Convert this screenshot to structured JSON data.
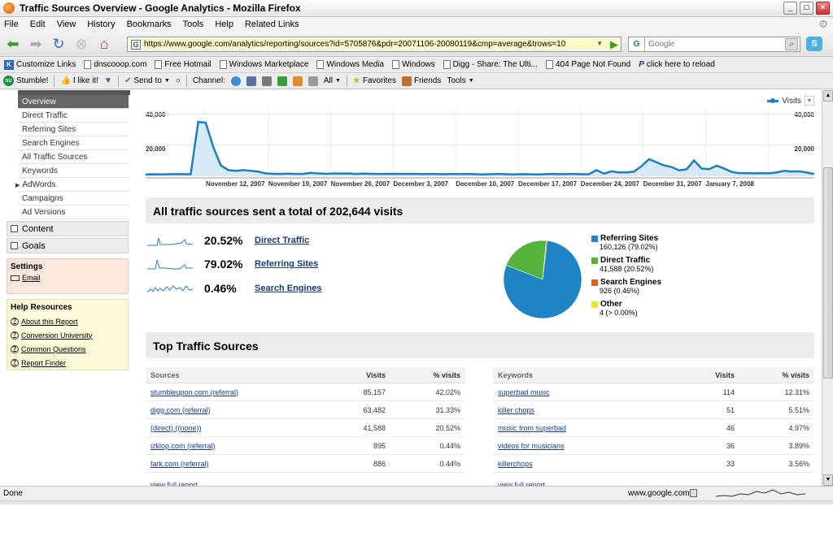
{
  "window": {
    "title": "Traffic Sources Overview - Google Analytics - Mozilla Firefox",
    "min_label": "_",
    "max_label": "□",
    "close_label": "×"
  },
  "menu": [
    "File",
    "Edit",
    "View",
    "History",
    "Bookmarks",
    "Tools",
    "Help",
    "Related Links"
  ],
  "nav": {
    "url": "https://www.google.com/analytics/reporting/sources?id=5705876&pdr=20071106-20080119&cmp=average&trows=10",
    "search_placeholder": "Google",
    "search_engine": "G",
    "skype": "S"
  },
  "bookmarks": [
    "Customize Links",
    "dnscooop.com",
    "Free Hotmail",
    "Windows Marketplace",
    "Windows Media",
    "Windows",
    "Digg - Share: The Ulti...",
    "404 Page Not Found",
    "click here to reload"
  ],
  "stumble": {
    "stumble": "Stumble!",
    "ilike": "I like it!",
    "sendto": "Send to",
    "channel": "Channel:",
    "all": "All",
    "favorites": "Favorites",
    "friends": "Friends",
    "tools": "Tools"
  },
  "sidebar": {
    "items": [
      "Overview",
      "Direct Traffic",
      "Referring Sites",
      "Search Engines",
      "All Traffic Sources",
      "Keywords",
      "AdWords",
      "Campaigns",
      "Ad Versions"
    ],
    "content_label": "Content",
    "goals_label": "Goals",
    "settings_title": "Settings",
    "email_label": "Email",
    "help_title": "Help Resources",
    "help_links": [
      "About this Report",
      "Conversion University",
      "Common Questions",
      "Report Finder"
    ]
  },
  "chart_data": {
    "type": "line",
    "legend": "Visits",
    "yticks": [
      "40,000",
      "20,000"
    ],
    "ylim": [
      0,
      45000
    ],
    "x_labels": [
      "November 12, 2007",
      "November 19, 2007",
      "November 26, 2007",
      "December 3, 2007",
      "December 10, 2007",
      "December 17, 2007",
      "December 24, 2007",
      "December 31, 2007",
      "January 7, 2008"
    ],
    "values": [
      1200,
      1300,
      1250,
      1300,
      1350,
      1400,
      1300,
      35000,
      34500,
      19000,
      7000,
      4000,
      3500,
      4000,
      3500,
      3000,
      1800,
      1600,
      1500,
      1700,
      1500,
      1600,
      2200,
      1800,
      1600,
      1800,
      1700,
      1800,
      1500,
      1700,
      1600,
      1500,
      1500,
      1600,
      1500,
      1600,
      1500,
      1400,
      1500,
      1400,
      1400,
      1500,
      1400,
      1500,
      1300,
      1200,
      1400,
      1500,
      1300,
      1200,
      1400,
      1300,
      1200,
      1300,
      1500,
      1400,
      1400,
      1500,
      1300,
      1300,
      4000,
      1700,
      3200,
      2500,
      2500,
      3000,
      6500,
      11000,
      9000,
      7000,
      6000,
      3800,
      4500,
      10200,
      5000,
      4600,
      6800,
      5000,
      2800,
      2000,
      2000,
      1900,
      2000,
      1900,
      2500,
      3500,
      3000,
      3200,
      2400,
      1500
    ]
  },
  "summary": {
    "headline": "All traffic sources sent a total of 202,644 visits",
    "rows": [
      {
        "pct": "20.52%",
        "label": "Direct Traffic"
      },
      {
        "pct": "79.02%",
        "label": "Referring Sites"
      },
      {
        "pct": "0.46%",
        "label": "Search Engines"
      }
    ]
  },
  "pie": {
    "slices": [
      {
        "name": "Referring Sites",
        "value": "160,126 (79.02%)",
        "pct": 79.02,
        "color": "#1d84c6"
      },
      {
        "name": "Direct Traffic",
        "value": "41,588 (20.52%)",
        "pct": 20.52,
        "color": "#55b33b"
      },
      {
        "name": "Search Engines",
        "value": "926 (0.46%)",
        "pct": 0.46,
        "color": "#e0621a"
      },
      {
        "name": "Other",
        "value": "4 (> 0.00%)",
        "pct": 0.0,
        "color": "#e9e51f"
      }
    ]
  },
  "top": {
    "title": "Top Traffic Sources",
    "sources_headers": [
      "Sources",
      "Visits",
      "% visits"
    ],
    "sources": [
      [
        "stumbleupon.com (referral)",
        "85,157",
        "42.02%"
      ],
      [
        "digg.com (referral)",
        "63,482",
        "31.33%"
      ],
      [
        "(direct) ((none))",
        "41,588",
        "20.52%"
      ],
      [
        "izklop.com (referral)",
        "895",
        "0.44%"
      ],
      [
        "fark.com (referral)",
        "886",
        "0.44%"
      ]
    ],
    "keywords_headers": [
      "Keywords",
      "Visits",
      "% visits"
    ],
    "keywords": [
      [
        "superbad music",
        "114",
        "12.31%"
      ],
      [
        "killer chops",
        "51",
        "5.51%"
      ],
      [
        "music from superbad",
        "46",
        "4.97%"
      ],
      [
        "videos for musicians",
        "36",
        "3.89%"
      ],
      [
        "killerchops",
        "33",
        "3.56%"
      ]
    ],
    "view_full": "view full report"
  },
  "status": {
    "done": "Done",
    "domain": "www.google.com"
  },
  "colors": {
    "line": "#1d7fc0",
    "fill": "#d6e9f5"
  }
}
